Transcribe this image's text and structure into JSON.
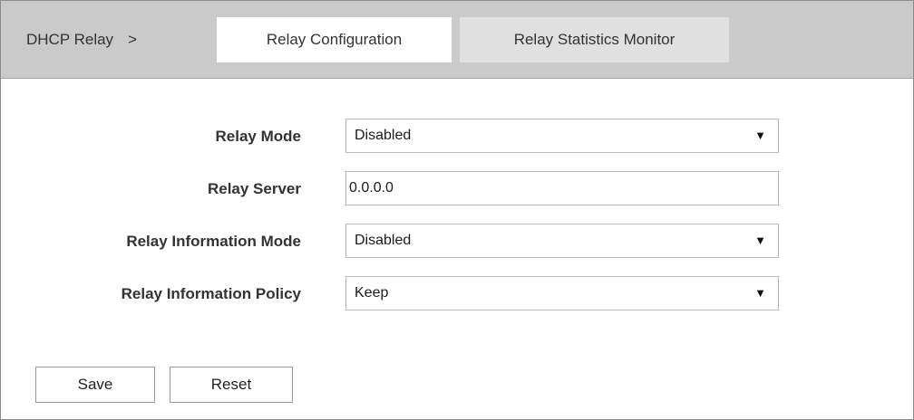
{
  "breadcrumb": {
    "label": "DHCP Relay",
    "separator": ">"
  },
  "tabs": {
    "config": {
      "label": "Relay Configuration",
      "active": true
    },
    "stats": {
      "label": "Relay Statistics Monitor",
      "active": false
    }
  },
  "form": {
    "relay_mode": {
      "label": "Relay Mode",
      "value": "Disabled"
    },
    "relay_server": {
      "label": "Relay Server",
      "value": "0.0.0.0"
    },
    "relay_info_mode": {
      "label": "Relay Information Mode",
      "value": "Disabled"
    },
    "relay_info_policy": {
      "label": "Relay Information Policy",
      "value": "Keep"
    },
    "dropdown_arrow": "▼"
  },
  "buttons": {
    "save": "Save",
    "reset": "Reset"
  },
  "colors": {
    "tabbar_bg": "#cacaca",
    "active_tab_bg": "#ffffff",
    "inactive_tab_bg": "#e0e0e0"
  }
}
